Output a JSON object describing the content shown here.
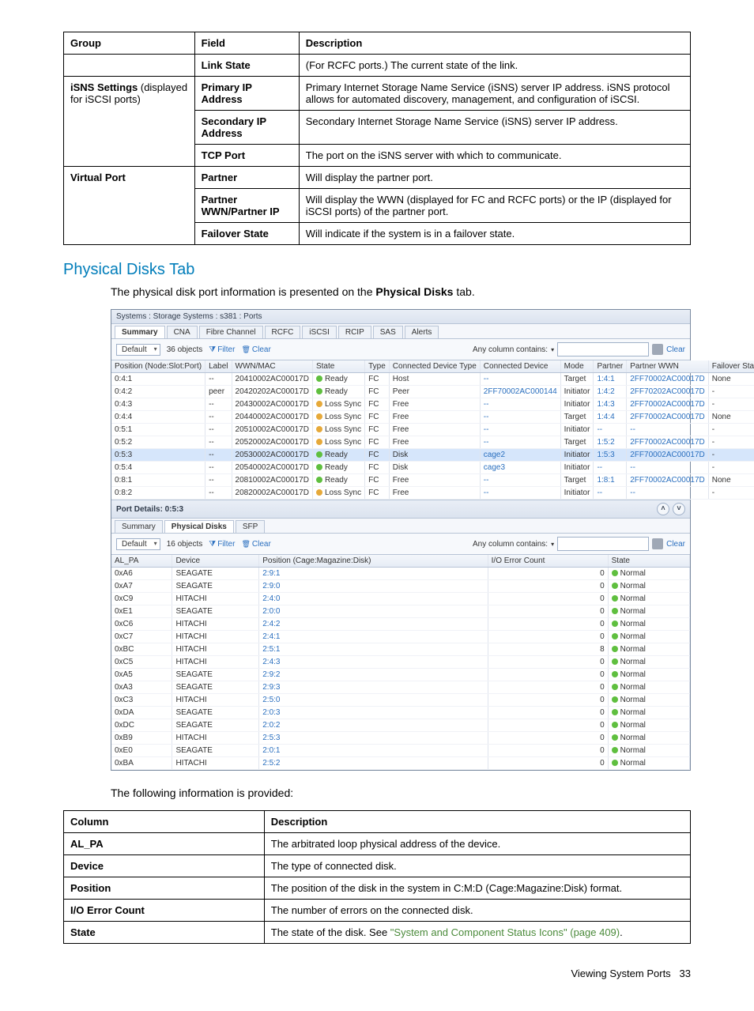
{
  "tableA": {
    "headers": [
      "Group",
      "Field",
      "Description"
    ],
    "rows": [
      {
        "group": "",
        "field": "Link State",
        "desc": "(For RCFC ports.) The current state of the link.",
        "groupBold": false
      },
      {
        "group": "iSNS Settings (displayed for iSCSI ports)",
        "field": "Primary IP Address",
        "desc": "Primary Internet Storage Name Service (iSNS) server IP address. iSNS protocol allows for automated discovery, management, and configuration of iSCSI.",
        "groupBold": true,
        "rowspan": 3
      },
      {
        "group": "",
        "field": "Secondary IP Address",
        "desc": "Secondary Internet Storage Name Service (iSNS) server IP address."
      },
      {
        "group": "",
        "field": "TCP Port",
        "desc": "The port on the iSNS server with which to communicate."
      },
      {
        "group": "Virtual Port",
        "field": "Partner",
        "desc": "Will display the partner port.",
        "groupBold": true,
        "rowspan": 3
      },
      {
        "group": "",
        "field": "Partner WWN/Partner IP",
        "desc": "Will display the WWN (displayed for FC and RCFC ports) or the IP (displayed for iSCSI ports) of the partner port."
      },
      {
        "group": "",
        "field": "Failover State",
        "desc": "Will indicate if the system is in a failover state."
      }
    ]
  },
  "sectionTitle": "Physical Disks Tab",
  "introText1a": "The physical disk port information is presented on the ",
  "introText1b": "Physical Disks",
  "introText1c": " tab.",
  "introText2": "The following information is provided:",
  "tableB": {
    "headers": [
      "Column",
      "Description"
    ],
    "rows": [
      {
        "col": "AL_PA",
        "desc": "The arbitrated loop physical address of the device."
      },
      {
        "col": "Device",
        "desc": "The type of connected disk."
      },
      {
        "col": "Position",
        "desc": "The position of the disk in the system in C:M:D (Cage:Magazine:Disk) format."
      },
      {
        "col": "I/O Error Count",
        "desc": "The number of errors on the connected disk."
      },
      {
        "col": "State",
        "descPre": "The state of the disk. See ",
        "descLink": "\"System and Component Status Icons\" (page 409)",
        "descPost": "."
      }
    ]
  },
  "footer": {
    "label": "Viewing System Ports",
    "page": "33"
  },
  "ss": {
    "breadcrumb": "Systems : Storage Systems : s381 : Ports",
    "mainTabs": [
      "Summary",
      "CNA",
      "Fibre Channel",
      "RCFC",
      "iSCSI",
      "RCIP",
      "SAS",
      "Alerts"
    ],
    "mainActive": 0,
    "toolbar": {
      "dropdown": "Default",
      "count": "36 objects",
      "filter": "Filter",
      "clear": "Clear",
      "anyCol": "Any column contains:",
      "clearBtn": "Clear"
    },
    "portCols": [
      "Position (Node:Slot:Port)",
      "Label",
      "WWN/MAC",
      "State",
      "Type",
      "Connected Device Type",
      "Connected Device",
      "Mode",
      "Partner",
      "Partner WWN",
      "Failover State"
    ],
    "portRows": [
      {
        "pos": "0:4:1",
        "label": "--",
        "wwn": "20410002AC00017D",
        "state": "Ready",
        "dot": "g",
        "type": "FC",
        "cdt": "Host",
        "cd": "--",
        "mode": "Target",
        "partner": "1:4:1",
        "pwwn": "2FF70002AC00017D",
        "fs": "None"
      },
      {
        "pos": "0:4:2",
        "label": "peer",
        "wwn": "20420202AC00017D",
        "state": "Ready",
        "dot": "g",
        "type": "FC",
        "cdt": "Peer",
        "cd": "2FF70002AC000144",
        "mode": "Initiator",
        "partner": "1:4:2",
        "pwwn": "2FF70202AC00017D",
        "fs": "-"
      },
      {
        "pos": "0:4:3",
        "label": "--",
        "wwn": "20430002AC00017D",
        "state": "Loss Sync",
        "dot": "a",
        "type": "FC",
        "cdt": "Free",
        "cd": "--",
        "mode": "Initiator",
        "partner": "1:4:3",
        "pwwn": "2FF70002AC00017D",
        "fs": "-"
      },
      {
        "pos": "0:4:4",
        "label": "--",
        "wwn": "20440002AC00017D",
        "state": "Loss Sync",
        "dot": "a",
        "type": "FC",
        "cdt": "Free",
        "cd": "--",
        "mode": "Target",
        "partner": "1:4:4",
        "pwwn": "2FF70002AC00017D",
        "fs": "None"
      },
      {
        "pos": "0:5:1",
        "label": "--",
        "wwn": "20510002AC00017D",
        "state": "Loss Sync",
        "dot": "a",
        "type": "FC",
        "cdt": "Free",
        "cd": "--",
        "mode": "Initiator",
        "partner": "--",
        "pwwn": "--",
        "fs": "-"
      },
      {
        "pos": "0:5:2",
        "label": "--",
        "wwn": "20520002AC00017D",
        "state": "Loss Sync",
        "dot": "a",
        "type": "FC",
        "cdt": "Free",
        "cd": "--",
        "mode": "Target",
        "partner": "1:5:2",
        "pwwn": "2FF70002AC00017D",
        "fs": "-"
      },
      {
        "pos": "0:5:3",
        "label": "--",
        "wwn": "20530002AC00017D",
        "state": "Ready",
        "dot": "g",
        "type": "FC",
        "cdt": "Disk",
        "cd": "cage2",
        "mode": "Initiator",
        "partner": "1:5:3",
        "pwwn": "2FF70002AC00017D",
        "fs": "-",
        "sel": true
      },
      {
        "pos": "0:5:4",
        "label": "--",
        "wwn": "20540002AC00017D",
        "state": "Ready",
        "dot": "g",
        "type": "FC",
        "cdt": "Disk",
        "cd": "cage3",
        "mode": "Initiator",
        "partner": "--",
        "pwwn": "--",
        "fs": "-"
      },
      {
        "pos": "0:8:1",
        "label": "--",
        "wwn": "20810002AC00017D",
        "state": "Ready",
        "dot": "g",
        "type": "FC",
        "cdt": "Free",
        "cd": "--",
        "mode": "Target",
        "partner": "1:8:1",
        "pwwn": "2FF70002AC00017D",
        "fs": "None"
      },
      {
        "pos": "0:8:2",
        "label": "--",
        "wwn": "20820002AC00017D",
        "state": "Loss Sync",
        "dot": "a",
        "type": "FC",
        "cdt": "Free",
        "cd": "--",
        "mode": "Initiator",
        "partner": "--",
        "pwwn": "--",
        "fs": "-"
      }
    ],
    "detailHeader": "Port Details: 0:5:3",
    "detailTabs": [
      "Summary",
      "Physical Disks",
      "SFP"
    ],
    "detailActive": 1,
    "detailToolbar": {
      "dropdown": "Default",
      "count": "16 objects",
      "filter": "Filter",
      "clear": "Clear",
      "anyCol": "Any column contains:",
      "clearBtn": "Clear"
    },
    "diskCols": [
      "AL_PA",
      "Device",
      "Position (Cage:Magazine:Disk)",
      "I/O Error Count",
      "State"
    ],
    "diskRows": [
      {
        "al": "0xA6",
        "dev": "SEAGATE",
        "pos": "2:9:1",
        "io": "0",
        "st": "Normal"
      },
      {
        "al": "0xA7",
        "dev": "SEAGATE",
        "pos": "2:9:0",
        "io": "0",
        "st": "Normal"
      },
      {
        "al": "0xC9",
        "dev": "HITACHI",
        "pos": "2:4:0",
        "io": "0",
        "st": "Normal"
      },
      {
        "al": "0xE1",
        "dev": "SEAGATE",
        "pos": "2:0:0",
        "io": "0",
        "st": "Normal"
      },
      {
        "al": "0xC6",
        "dev": "HITACHI",
        "pos": "2:4:2",
        "io": "0",
        "st": "Normal"
      },
      {
        "al": "0xC7",
        "dev": "HITACHI",
        "pos": "2:4:1",
        "io": "0",
        "st": "Normal"
      },
      {
        "al": "0xBC",
        "dev": "HITACHI",
        "pos": "2:5:1",
        "io": "8",
        "st": "Normal"
      },
      {
        "al": "0xC5",
        "dev": "HITACHI",
        "pos": "2:4:3",
        "io": "0",
        "st": "Normal"
      },
      {
        "al": "0xA5",
        "dev": "SEAGATE",
        "pos": "2:9:2",
        "io": "0",
        "st": "Normal"
      },
      {
        "al": "0xA3",
        "dev": "SEAGATE",
        "pos": "2:9:3",
        "io": "0",
        "st": "Normal"
      },
      {
        "al": "0xC3",
        "dev": "HITACHI",
        "pos": "2:5:0",
        "io": "0",
        "st": "Normal"
      },
      {
        "al": "0xDA",
        "dev": "SEAGATE",
        "pos": "2:0:3",
        "io": "0",
        "st": "Normal"
      },
      {
        "al": "0xDC",
        "dev": "SEAGATE",
        "pos": "2:0:2",
        "io": "0",
        "st": "Normal"
      },
      {
        "al": "0xB9",
        "dev": "HITACHI",
        "pos": "2:5:3",
        "io": "0",
        "st": "Normal"
      },
      {
        "al": "0xE0",
        "dev": "SEAGATE",
        "pos": "2:0:1",
        "io": "0",
        "st": "Normal"
      },
      {
        "al": "0xBA",
        "dev": "HITACHI",
        "pos": "2:5:2",
        "io": "0",
        "st": "Normal"
      }
    ]
  }
}
